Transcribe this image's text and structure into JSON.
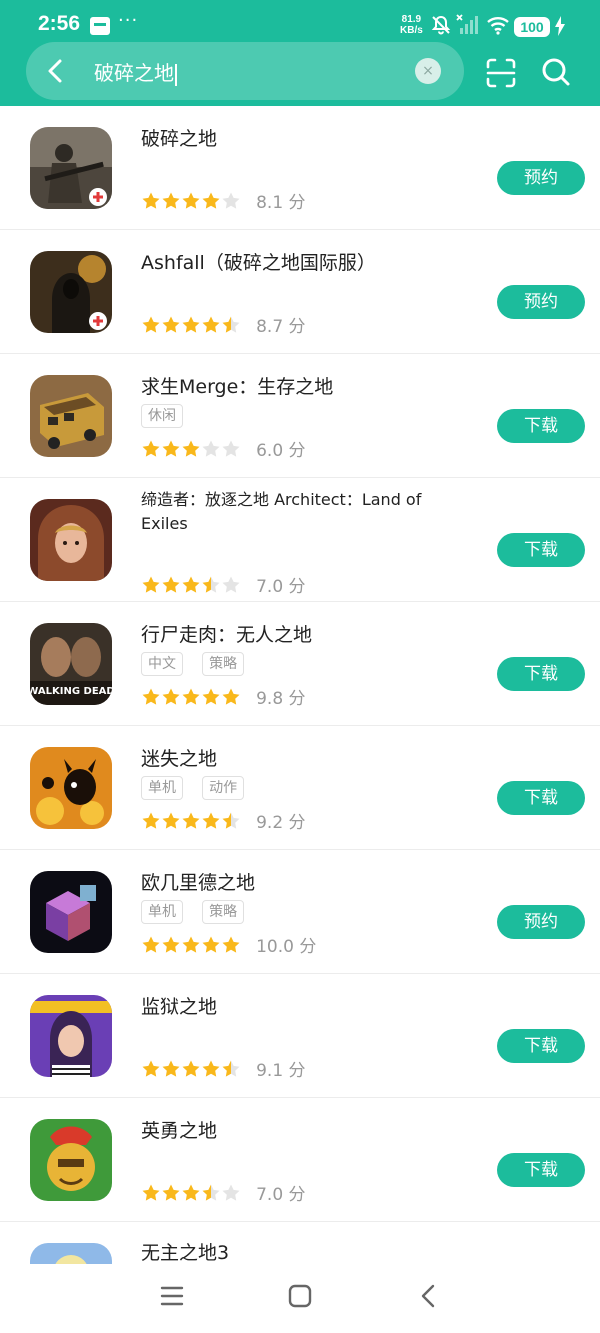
{
  "status_bar": {
    "time": "2:56",
    "more": "···",
    "speed_value": "81.9",
    "speed_unit": "KB/s",
    "battery": "100"
  },
  "search": {
    "query": "破碎之地",
    "clear_symbol": "×"
  },
  "colors": {
    "brand": "#1cbc9c",
    "star": "#f9b81b",
    "star_empty": "#e4e4e4"
  },
  "apps": [
    {
      "name": "破碎之地",
      "tags": [],
      "rating": 4,
      "score": "8.1 分",
      "action": "预约",
      "icon": "soldier-rifle-icon"
    },
    {
      "name": "Ashfall（破碎之地国际服）",
      "tags": [],
      "rating": 4.5,
      "score": "8.7 分",
      "action": "预约",
      "icon": "hooded-survivor-icon"
    },
    {
      "name": "求生Merge：生存之地",
      "tags": [
        "休闲"
      ],
      "rating": 3,
      "score": "6.0 分",
      "action": "下载",
      "icon": "armored-bus-icon"
    },
    {
      "name": "缔造者：放逐之地 Architect：Land of Exiles",
      "tags": [],
      "rating": 3.5,
      "score": "7.0 分",
      "action": "下载",
      "icon": "hooded-heroine-icon"
    },
    {
      "name": "行尸走肉：无人之地",
      "tags": [
        "中文",
        "策略"
      ],
      "rating": 5,
      "score": "9.8 分",
      "action": "下载",
      "icon": "walking-dead-icon"
    },
    {
      "name": "迷失之地",
      "tags": [
        "单机",
        "动作"
      ],
      "rating": 4.5,
      "score": "9.2 分",
      "action": "下载",
      "icon": "shadow-creature-icon"
    },
    {
      "name": "欧几里德之地",
      "tags": [
        "单机",
        "策略"
      ],
      "rating": 5,
      "score": "10.0 分",
      "action": "预约",
      "icon": "cube-icon"
    },
    {
      "name": "监狱之地",
      "tags": [],
      "rating": 4.5,
      "score": "9.1 分",
      "action": "下载",
      "icon": "prisoner-girl-icon"
    },
    {
      "name": "英勇之地",
      "tags": [],
      "rating": 3.5,
      "score": "7.0 分",
      "action": "下载",
      "icon": "spartan-helmet-icon"
    },
    {
      "name": "无主之地3",
      "tags": [],
      "rating": 0,
      "score": "",
      "action": "",
      "icon": "game-icon"
    }
  ],
  "walking_dead_logo": "WALKING DEAD"
}
